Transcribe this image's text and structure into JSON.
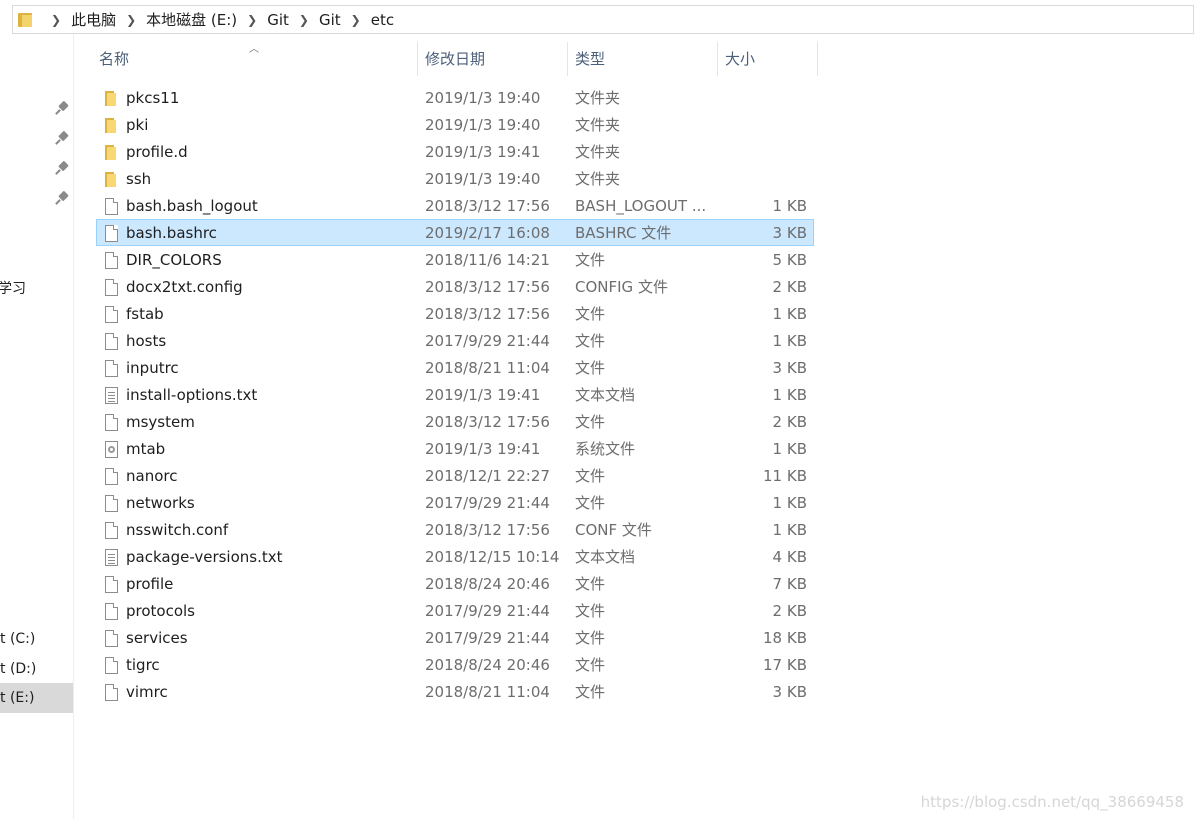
{
  "address_bar": {
    "crumbs": [
      "此电脑",
      "本地磁盘 (E:)",
      "Git",
      "Git",
      "etc"
    ]
  },
  "nav_pane": {
    "partial_label": "学习",
    "drives": [
      "t (C:)",
      "t (D:)",
      "t (E:)"
    ],
    "selected_drive": "t (E:)"
  },
  "columns": {
    "name": "名称",
    "date": "修改日期",
    "type": "类型",
    "size": "大小"
  },
  "files": [
    {
      "name": "pkcs11",
      "date": "2019/1/3 19:40",
      "type": "文件夹",
      "size": "",
      "icon": "folder-icon"
    },
    {
      "name": "pki",
      "date": "2019/1/3 19:40",
      "type": "文件夹",
      "size": "",
      "icon": "folder-icon"
    },
    {
      "name": "profile.d",
      "date": "2019/1/3 19:41",
      "type": "文件夹",
      "size": "",
      "icon": "folder-icon"
    },
    {
      "name": "ssh",
      "date": "2019/1/3 19:40",
      "type": "文件夹",
      "size": "",
      "icon": "folder-icon"
    },
    {
      "name": "bash.bash_logout",
      "date": "2018/3/12 17:56",
      "type": "BASH_LOGOUT ...",
      "size": "1 KB",
      "icon": "file-icon"
    },
    {
      "name": "bash.bashrc",
      "date": "2019/2/17 16:08",
      "type": "BASHRC 文件",
      "size": "3 KB",
      "icon": "file-icon",
      "selected": true
    },
    {
      "name": "DIR_COLORS",
      "date": "2018/11/6 14:21",
      "type": "文件",
      "size": "5 KB",
      "icon": "file-icon"
    },
    {
      "name": "docx2txt.config",
      "date": "2018/3/12 17:56",
      "type": "CONFIG 文件",
      "size": "2 KB",
      "icon": "file-icon"
    },
    {
      "name": "fstab",
      "date": "2018/3/12 17:56",
      "type": "文件",
      "size": "1 KB",
      "icon": "file-icon"
    },
    {
      "name": "hosts",
      "date": "2017/9/29 21:44",
      "type": "文件",
      "size": "1 KB",
      "icon": "file-icon"
    },
    {
      "name": "inputrc",
      "date": "2018/8/21 11:04",
      "type": "文件",
      "size": "3 KB",
      "icon": "file-icon"
    },
    {
      "name": "install-options.txt",
      "date": "2019/1/3 19:41",
      "type": "文本文档",
      "size": "1 KB",
      "icon": "text-file-icon"
    },
    {
      "name": "msystem",
      "date": "2018/3/12 17:56",
      "type": "文件",
      "size": "2 KB",
      "icon": "file-icon"
    },
    {
      "name": "mtab",
      "date": "2019/1/3 19:41",
      "type": "系统文件",
      "size": "1 KB",
      "icon": "system-file-icon"
    },
    {
      "name": "nanorc",
      "date": "2018/12/1 22:27",
      "type": "文件",
      "size": "11 KB",
      "icon": "file-icon"
    },
    {
      "name": "networks",
      "date": "2017/9/29 21:44",
      "type": "文件",
      "size": "1 KB",
      "icon": "file-icon"
    },
    {
      "name": "nsswitch.conf",
      "date": "2018/3/12 17:56",
      "type": "CONF 文件",
      "size": "1 KB",
      "icon": "file-icon"
    },
    {
      "name": "package-versions.txt",
      "date": "2018/12/15 10:14",
      "type": "文本文档",
      "size": "4 KB",
      "icon": "text-file-icon"
    },
    {
      "name": "profile",
      "date": "2018/8/24 20:46",
      "type": "文件",
      "size": "7 KB",
      "icon": "file-icon"
    },
    {
      "name": "protocols",
      "date": "2017/9/29 21:44",
      "type": "文件",
      "size": "2 KB",
      "icon": "file-icon"
    },
    {
      "name": "services",
      "date": "2017/9/29 21:44",
      "type": "文件",
      "size": "18 KB",
      "icon": "file-icon"
    },
    {
      "name": "tigrc",
      "date": "2018/8/24 20:46",
      "type": "文件",
      "size": "17 KB",
      "icon": "file-icon"
    },
    {
      "name": "vimrc",
      "date": "2018/8/21 11:04",
      "type": "文件",
      "size": "3 KB",
      "icon": "file-icon"
    }
  ],
  "watermark": "https://blog.csdn.net/qq_38669458",
  "colors": {
    "selection_bg": "#cce8ff",
    "selection_border": "#99d1ff",
    "header_text": "#4c607a",
    "folder_yellow": "#f8d775"
  }
}
